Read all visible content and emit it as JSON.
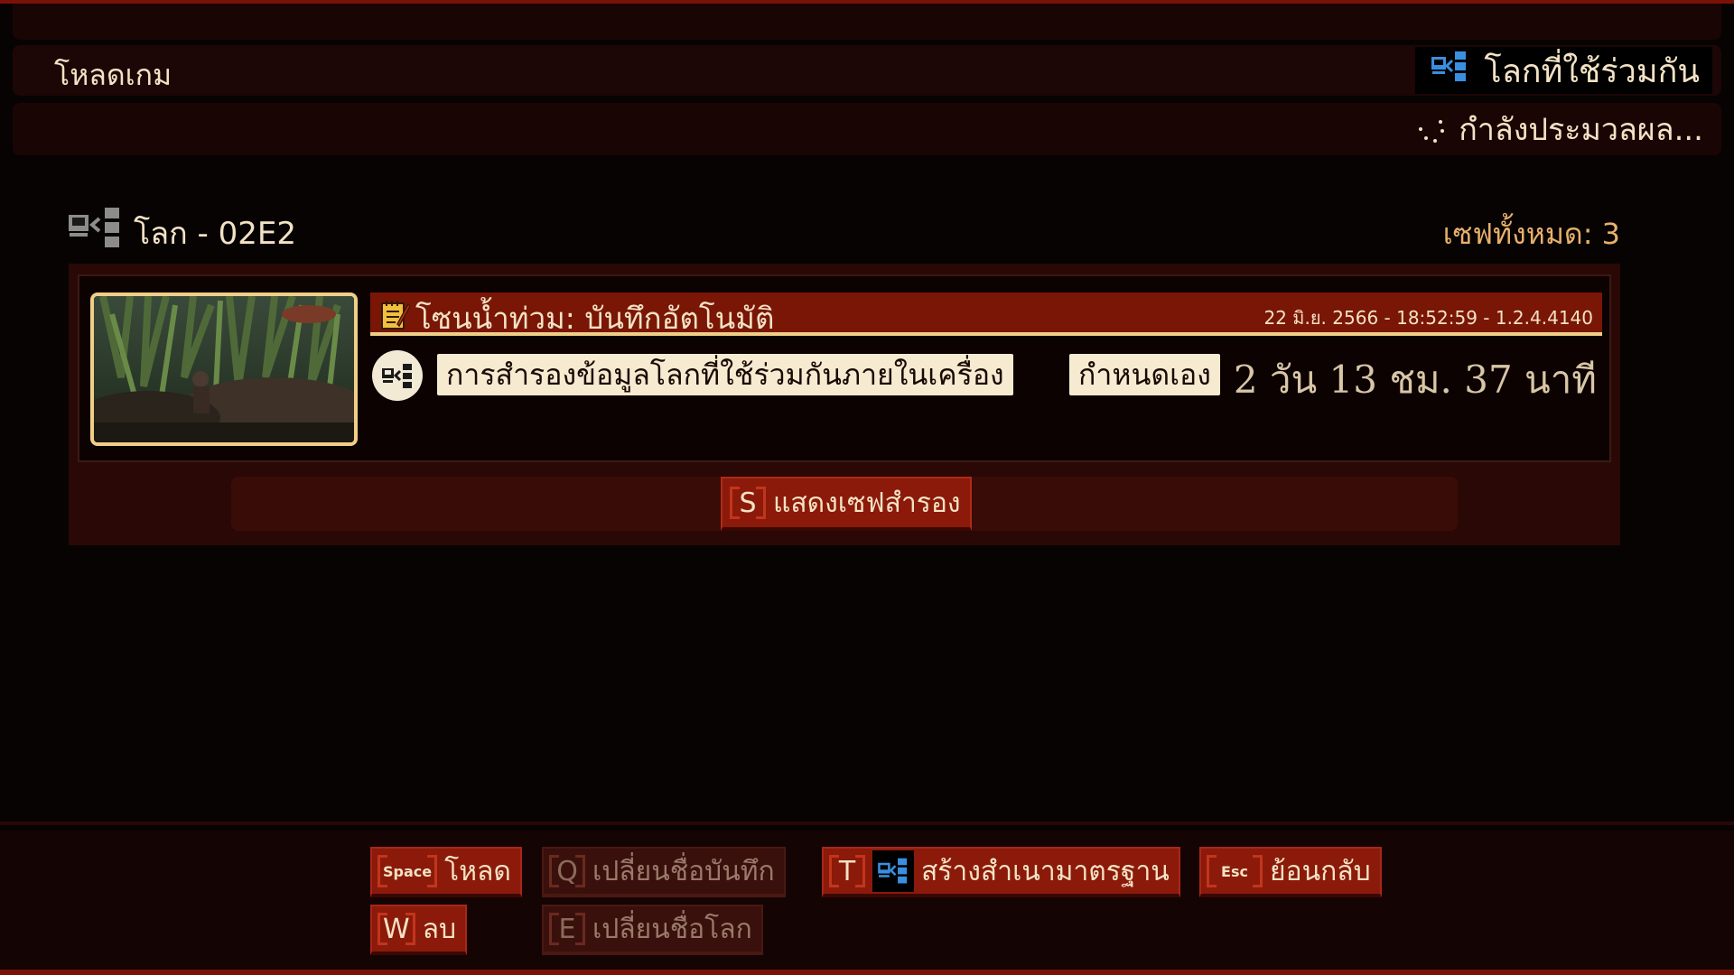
{
  "header": {
    "title": "โหลดเกม",
    "shared_world_label": "โลกที่ใช้ร่วมกัน",
    "status_text": "กำลังประมวลผล..."
  },
  "world": {
    "title": "โลก - 02E2",
    "save_count": "เซฟทั้งหมด: 3"
  },
  "save": {
    "name": "โซนน้ำท่วม: บันทึกอัตโนมัติ",
    "meta": "22 มิ.ย. 2566 - 18:52:59 - 1.2.4.4140",
    "tags": [
      "การสำรองข้อมูลโลกที่ใช้ร่วมกันภายในเครื่อง",
      "กำหนดเอง"
    ],
    "playtime": "2 วัน 13 ชม. 37 นาที"
  },
  "backup_button": {
    "key": "S",
    "label": "แสดงเซฟสำรอง"
  },
  "actions": {
    "load": {
      "key": "Space",
      "label": "โหลด"
    },
    "rename_save": {
      "key": "Q",
      "label": "เปลี่ยนชื่อบันทึก"
    },
    "make_standard_copy": {
      "key": "T",
      "label": "สร้างสำเนามาตรฐาน"
    },
    "back": {
      "key": "Esc",
      "label": "ย้อนกลับ"
    },
    "delete": {
      "key": "W",
      "label": "ลบ"
    },
    "rename_world": {
      "key": "E",
      "label": "เปลี่ยนชื่อโลก"
    }
  },
  "colors": {
    "accent_red": "#8b1a0a",
    "gold": "#f0cf86",
    "count_orange": "#e8b06a",
    "shared_icon_blue": "#3a8fe0"
  },
  "icons": {
    "shared_world": "shared-world-icon",
    "local_world": "local-world-icon",
    "save_note": "notepad-icon",
    "spinner": "loading-spinner-icon"
  }
}
